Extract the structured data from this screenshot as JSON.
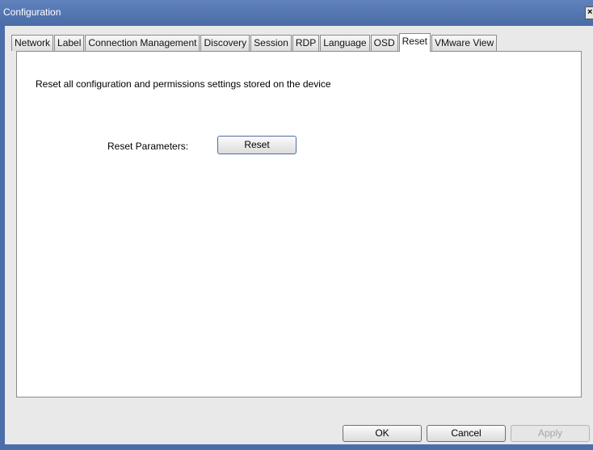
{
  "window": {
    "title": "Configuration",
    "close_glyph": "×"
  },
  "tabs": [
    {
      "label": "Network"
    },
    {
      "label": "Label"
    },
    {
      "label": "Connection Management"
    },
    {
      "label": "Discovery"
    },
    {
      "label": "Session"
    },
    {
      "label": "RDP"
    },
    {
      "label": "Language"
    },
    {
      "label": "OSD"
    },
    {
      "label": "Reset",
      "active": true
    },
    {
      "label": "VMware View"
    }
  ],
  "panel": {
    "description": "Reset all configuration and permissions settings stored on the device",
    "reset_label": "Reset Parameters:",
    "reset_button": "Reset"
  },
  "footer": {
    "ok": "OK",
    "cancel": "Cancel",
    "apply": "Apply"
  },
  "colors": {
    "titlebar": "#4b6eaa",
    "client_bg": "#e9e9e9",
    "panel_bg": "#ffffff"
  }
}
